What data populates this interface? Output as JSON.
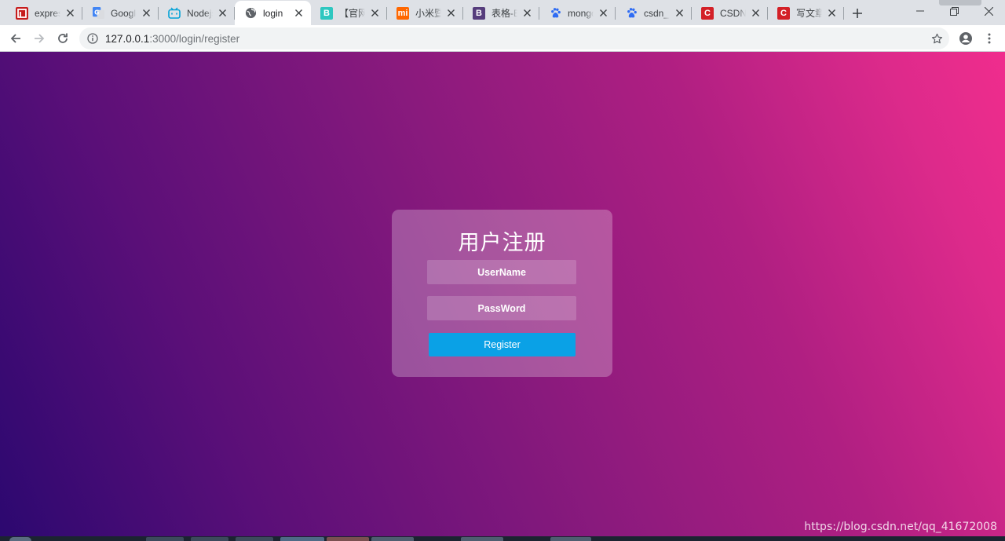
{
  "browser": {
    "tabs": [
      {
        "title": "express",
        "favicon_text": "",
        "favicon_color": "#c61c1c",
        "icon": "huawei-icon"
      },
      {
        "title": "Google",
        "favicon_text": "G",
        "favicon_color": "#4285f4",
        "icon": "google-translate-icon"
      },
      {
        "title": "Nodejs",
        "favicon_text": "",
        "favicon_color": "#00a1d6",
        "icon": "bilibili-icon"
      },
      {
        "title": "login",
        "favicon_text": "",
        "favicon_color": "#5f6368",
        "icon": "globe-icon",
        "active": true
      },
      {
        "title": "【官网",
        "favicon_text": "B",
        "favicon_color": "#2ec7c0",
        "icon": "b-icon"
      },
      {
        "title": "小米暨",
        "favicon_text": "mi",
        "favicon_color": "#ff6700",
        "icon": "xiaomi-icon"
      },
      {
        "title": "表格-Bo",
        "favicon_text": "B",
        "favicon_color": "#563d7c",
        "icon": "bootstrap-icon"
      },
      {
        "title": "mongo",
        "favicon_text": "",
        "favicon_color": "#2f6cf3",
        "icon": "baidu-paw-icon"
      },
      {
        "title": "csdn_百",
        "favicon_text": "",
        "favicon_color": "#2f6cf3",
        "icon": "baidu-paw-icon"
      },
      {
        "title": "CSDN-",
        "favicon_text": "C",
        "favicon_color": "#d32027",
        "icon": "csdn-icon"
      },
      {
        "title": "写文章",
        "favicon_text": "C",
        "favicon_color": "#d32027",
        "icon": "csdn-icon"
      }
    ],
    "address": {
      "host": "127.0.0.1",
      "path": ":3000/login/register"
    }
  },
  "page": {
    "heading": "用户注册",
    "username_placeholder": "UserName",
    "password_placeholder": "PassWord",
    "submit_label": "Register",
    "accent_color": "#0aa1e6",
    "watermark": "https://blog.csdn.net/qq_41672008"
  }
}
